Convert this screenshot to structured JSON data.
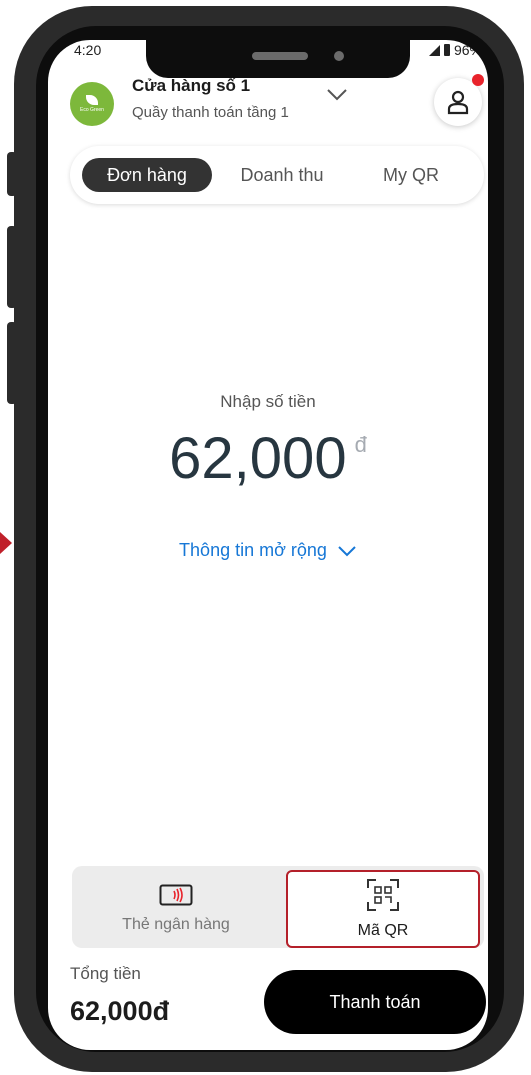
{
  "status": {
    "time": "4:20",
    "battery": "96%"
  },
  "store": {
    "name": "Cửa hàng số 1",
    "counter": "Quầy thanh toán tầng 1",
    "logo_text": "Eco Green"
  },
  "tabs": [
    {
      "label": "Đơn hàng",
      "active": true
    },
    {
      "label": "Doanh thu",
      "active": false
    },
    {
      "label": "My QR",
      "active": false
    }
  ],
  "entry": {
    "label": "Nhập số tiền",
    "amount": "62,000",
    "currency": "đ",
    "more_info": "Thông tin mở rộng"
  },
  "payment_methods": [
    {
      "label": "Thẻ ngân hàng",
      "icon": "nfc-card-icon",
      "selected": false
    },
    {
      "label": "Mã QR",
      "icon": "qr-scan-icon",
      "selected": true
    }
  ],
  "footer": {
    "total_label": "Tổng tiền",
    "total_value": "62,000đ",
    "pay_button": "Thanh toán"
  },
  "colors": {
    "accent": "#1677d6",
    "notification": "#e8232b",
    "selection_border": "#b4202a",
    "primary_button": "#000000"
  }
}
